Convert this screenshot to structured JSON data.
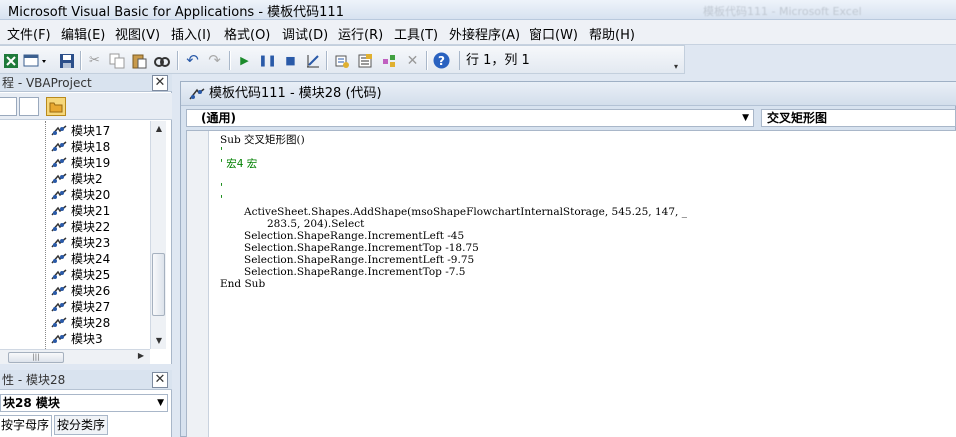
{
  "window": {
    "title": "Microsoft Visual Basic for Applications - 模板代码111",
    "ghost_title": "模板代码111 - Microsoft Excel"
  },
  "menu": {
    "items": [
      "文件(F)",
      "编辑(E)",
      "视图(V)",
      "插入(I)",
      "格式(O)",
      "调试(D)",
      "运行(R)",
      "工具(T)",
      "外接程序(A)",
      "窗口(W)",
      "帮助(H)"
    ]
  },
  "toolbar": {
    "position_label": "行 1，列 1",
    "icons": [
      "excel-icon",
      "insert-userform-icon",
      "save-icon",
      "cut-icon",
      "copy-icon",
      "paste-icon",
      "find-icon",
      "undo-icon",
      "redo-icon",
      "run-icon",
      "break-icon",
      "reset-icon",
      "design-mode-icon",
      "project-explorer-icon",
      "properties-icon",
      "object-browser-icon",
      "toolbox-icon",
      "help-icon"
    ]
  },
  "project_panel": {
    "title": "程 - VBAProject",
    "items": [
      "模块17",
      "模块18",
      "模块19",
      "模块2",
      "模块20",
      "模块21",
      "模块22",
      "模块23",
      "模块24",
      "模块25",
      "模块26",
      "模块27",
      "模块28",
      "模块3"
    ]
  },
  "properties_panel": {
    "title": "性 - 模块28",
    "selected_object": "块28 模块",
    "tabs": [
      "按字母序",
      "按分类序"
    ]
  },
  "code_window": {
    "title": "模板代码111 - 模块28 (代码)",
    "object_select": "(通用)",
    "procedure_select": "交叉矩形图",
    "lines": {
      "l1": "Sub 交叉矩形图()",
      "l2": "'",
      "l3": "' 宏4 宏",
      "l4": "'",
      "l5": "'",
      "l6": "ActiveSheet.Shapes.AddShape(msoShapeFlowchartInternalStorage, 545.25, 147, _",
      "l7": "283.5, 204).Select",
      "l8": "Selection.ShapeRange.IncrementLeft -45",
      "l9": "Selection.ShapeRange.IncrementTop -18.75",
      "l10": "Selection.ShapeRange.IncrementLeft -9.75",
      "l11": "Selection.ShapeRange.IncrementTop -7.5",
      "l12": "End Sub"
    }
  },
  "colors": {
    "comment": "#008000",
    "chrome": "#dfe7f2",
    "title_accent": "#d9e3ef"
  }
}
